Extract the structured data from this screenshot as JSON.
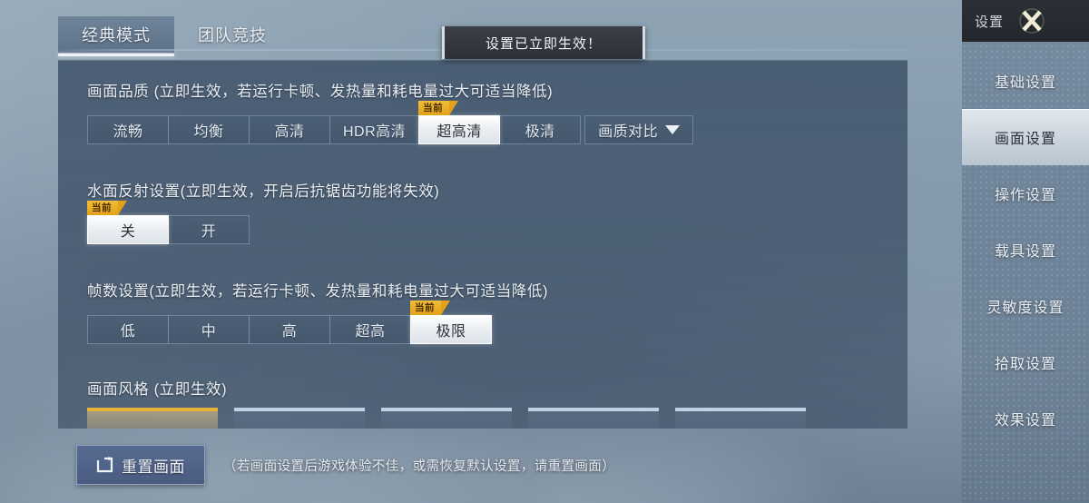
{
  "toast": {
    "message": "设置已立即生效！"
  },
  "tabs": [
    {
      "label": "经典模式",
      "active": true
    },
    {
      "label": "团队竞技",
      "active": false
    }
  ],
  "sections": {
    "quality": {
      "title": "画面品质 (立即生效，若运行卡顿、发热量和耗电量过大可适当降低)",
      "options": [
        "流畅",
        "均衡",
        "高清",
        "HDR高清",
        "超高清",
        "极清"
      ],
      "selected": "超高清",
      "badge_label": "当前",
      "dropdown_label": "画质对比"
    },
    "water": {
      "title": "水面反射设置(立即生效，开启后抗锯齿功能将失效)",
      "options": [
        "关",
        "开"
      ],
      "selected": "关",
      "badge_label": "当前"
    },
    "framerate": {
      "title": "帧数设置(立即生效，若运行卡顿、发热量和耗电量过大可适当降低)",
      "options": [
        "低",
        "中",
        "高",
        "超高",
        "极限"
      ],
      "selected": "极限",
      "badge_label": "当前"
    },
    "style": {
      "title": "画面风格 (立即生效)",
      "card_count": 5,
      "selected_index": 0
    }
  },
  "footer": {
    "reset_label": "重置画面",
    "hint": "（若画面设置后游戏体验不佳，或需恢复默认设置，请重置画面）"
  },
  "sidebar": {
    "title": "设置",
    "close_icon": "close-x-icon",
    "items": [
      {
        "label": "基础设置",
        "active": false
      },
      {
        "label": "画面设置",
        "active": true
      },
      {
        "label": "操作设置",
        "active": false
      },
      {
        "label": "载具设置",
        "active": false
      },
      {
        "label": "灵敏度设置",
        "active": false
      },
      {
        "label": "拾取设置",
        "active": false
      },
      {
        "label": "效果设置",
        "active": false
      }
    ]
  },
  "colors": {
    "accent_gold": "#e2a118",
    "selected_bg": "#eef2f6",
    "panel_bg": "#3e5066",
    "toast_bg": "#2c3137"
  }
}
